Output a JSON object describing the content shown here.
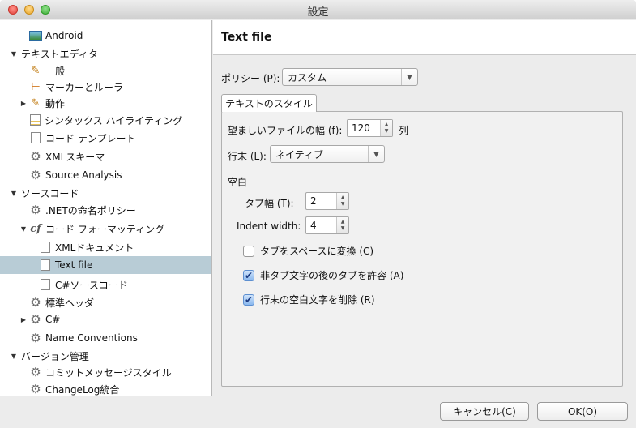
{
  "window": {
    "title": "設定"
  },
  "tree": {
    "items": [
      {
        "label": "Android",
        "icon": "android-icon"
      },
      {
        "label": "テキストエディタ"
      },
      {
        "label": "一般",
        "icon": "pencil-icon"
      },
      {
        "label": "マーカーとルーラ",
        "icon": "ruler-icon"
      },
      {
        "label": "動作",
        "icon": "pencil-icon"
      },
      {
        "label": "シンタックス ハイライティング",
        "icon": "highlight-icon"
      },
      {
        "label": "コード テンプレート",
        "icon": "template-icon"
      },
      {
        "label": "XMLスキーマ",
        "icon": "gear-icon"
      },
      {
        "label": "Source Analysis",
        "icon": "gear-icon"
      },
      {
        "label": "ソースコード"
      },
      {
        "label": ".NETの命名ポリシー",
        "icon": "gear-icon"
      },
      {
        "label": "コード フォーマッティング",
        "icon": "code-format-icon"
      },
      {
        "label": "XMLドキュメント",
        "icon": "document-icon"
      },
      {
        "label": "Text file",
        "icon": "document-icon",
        "selected": true
      },
      {
        "label": "C#ソースコード",
        "icon": "document-icon"
      },
      {
        "label": "標準ヘッダ",
        "icon": "gear-icon"
      },
      {
        "label": "C#",
        "icon": "gear-icon"
      },
      {
        "label": "Name Conventions",
        "icon": "gear-icon"
      },
      {
        "label": "バージョン管理"
      },
      {
        "label": "コミットメッセージスタイル",
        "icon": "gear-icon"
      },
      {
        "label": "ChangeLog統合",
        "icon": "gear-icon"
      }
    ]
  },
  "panel": {
    "title": "Text file",
    "policy_label": "ポリシー (P):",
    "policy_value": "カスタム",
    "tab_label": "テキストのスタイル",
    "width_label": "望ましいファイルの幅 (f):",
    "width_value": "120",
    "width_unit": "列",
    "eol_label": "行末 (L):",
    "eol_value": "ネイティブ",
    "whitespace_heading": "空白",
    "tab_width_label": "タブ幅 (T):",
    "tab_width_value": "2",
    "indent_width_label": "Indent width:",
    "indent_width_value": "4",
    "options": [
      {
        "label": "タブをスペースに変換 (C)",
        "checked": false
      },
      {
        "label": "非タブ文字の後のタブを許容 (A)",
        "checked": true
      },
      {
        "label": "行末の空白文字を削除 (R)",
        "checked": true
      }
    ]
  },
  "footer": {
    "cancel": "キャンセル(C)",
    "ok": "OK(O)"
  }
}
